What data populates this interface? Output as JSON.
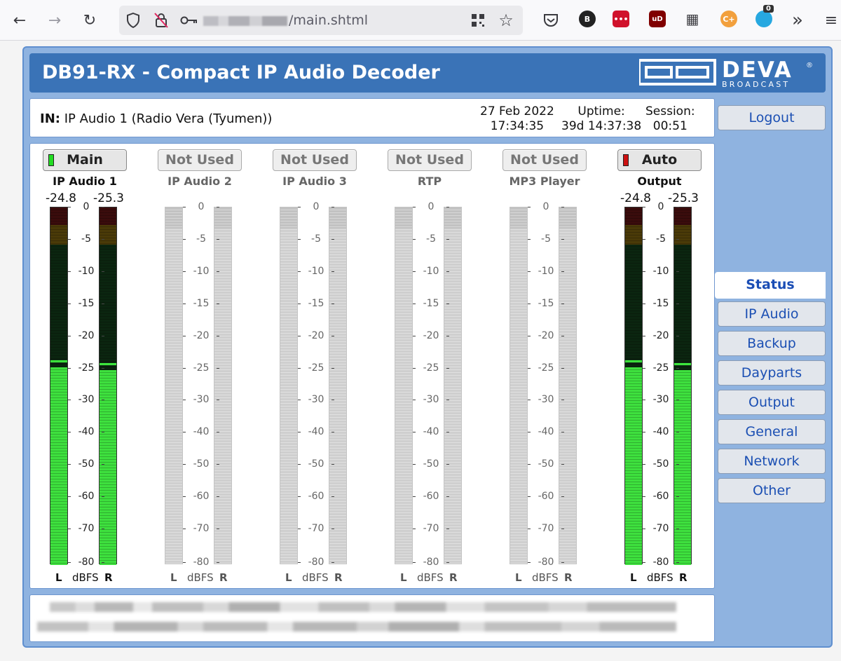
{
  "browser": {
    "url_suffix": "/main.shtml",
    "extension_badge": "0"
  },
  "app": {
    "title": "DB91-RX - Compact IP Audio Decoder",
    "logo_name": "DEVA",
    "logo_sub": "BROADCAST"
  },
  "info": {
    "in_label": "IN:",
    "in_value": "IP Audio 1 (Radio Vera (Tyumen))",
    "date": "27 Feb 2022",
    "time": "17:34:35",
    "uptime_label": "Uptime:",
    "uptime_value": "39d 14:37:38",
    "session_label": "Session:",
    "session_value": "00:51"
  },
  "nav": {
    "logout": "Logout",
    "items": [
      "Status",
      "IP Audio",
      "Backup",
      "Dayparts",
      "Output",
      "General",
      "Network",
      "Other"
    ],
    "active": "Status"
  },
  "scale_labels": [
    "0",
    "-5",
    "-10",
    "-15",
    "-20",
    "-25",
    "-30",
    "-40",
    "-50",
    "-60",
    "-70",
    "-80"
  ],
  "units": {
    "left": "L",
    "mid": "dBFS",
    "right": "R"
  },
  "channels": [
    {
      "button": "Main",
      "name": "IP Audio 1",
      "peak_l": "-24.8",
      "peak_r": "-25.3",
      "active": true,
      "led": "#22dd22",
      "level_l": -24.8,
      "level_r": -25.3
    },
    {
      "button": "Not Used",
      "name": "IP Audio 2",
      "active": false
    },
    {
      "button": "Not Used",
      "name": "IP Audio 3",
      "active": false
    },
    {
      "button": "Not Used",
      "name": "RTP",
      "active": false
    },
    {
      "button": "Not Used",
      "name": "MP3 Player",
      "active": false
    },
    {
      "button": "Auto",
      "name": "Output",
      "peak_l": "-24.8",
      "peak_r": "-25.3",
      "active": true,
      "led": "#cc1111",
      "level_l": -24.8,
      "level_r": -25.3
    }
  ],
  "colors": {
    "header_bg": "#3a73b7",
    "frame_bg": "#8fb3e0",
    "meter_green": "#3ee03e",
    "meter_yellow": "#a08a1a",
    "meter_red": "#7a1010",
    "nav_text": "#1b4fb3"
  }
}
